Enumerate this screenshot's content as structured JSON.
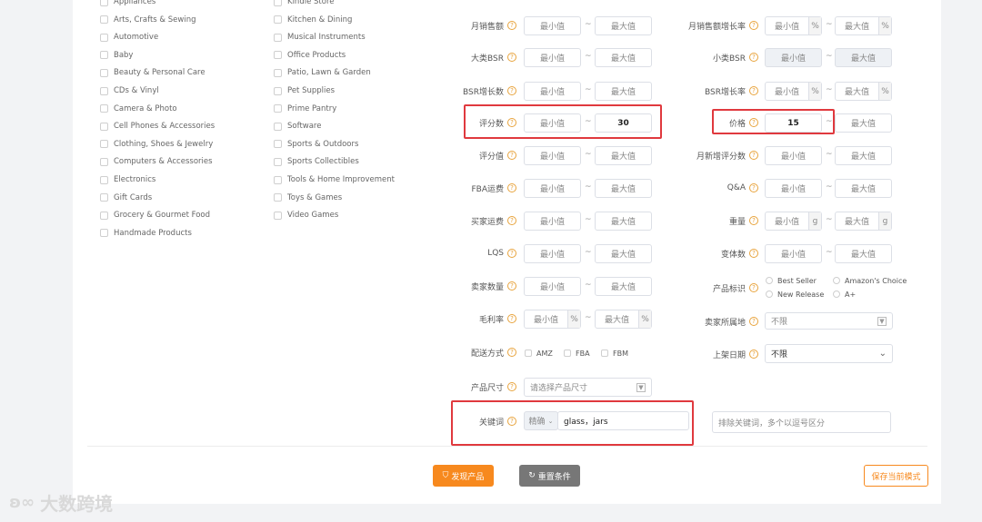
{
  "categories": {
    "col1": [
      "Appliances",
      "Arts, Crafts & Sewing",
      "Automotive",
      "Baby",
      "Beauty & Personal Care",
      "CDs & Vinyl",
      "Camera & Photo",
      "Cell Phones & Accessories",
      "Clothing, Shoes & Jewelry",
      "Computers & Accessories",
      "Electronics",
      "Gift Cards",
      "Grocery & Gourmet Food",
      "Handmade Products"
    ],
    "col2": [
      "Kindle Store",
      "Kitchen & Dining",
      "Musical Instruments",
      "Office Products",
      "Patio, Lawn & Garden",
      "Pet Supplies",
      "Prime Pantry",
      "Software",
      "Sports & Outdoors",
      "Sports Collectibles",
      "Tools & Home Improvement",
      "Toys & Games",
      "Video Games"
    ]
  },
  "placeholders": {
    "min": "最小值",
    "max": "最大值"
  },
  "filters": {
    "monthly_sales": {
      "label": "月销售额"
    },
    "big_bsr": {
      "label": "大类BSR"
    },
    "bsr_growth": {
      "label": "BSR增长数"
    },
    "review_count": {
      "label": "评分数",
      "max": "30"
    },
    "rating": {
      "label": "评分值"
    },
    "fba_fee": {
      "label": "FBA运费"
    },
    "buyer_shipping": {
      "label": "买家运费"
    },
    "lqs": {
      "label": "LQS"
    },
    "seller_count": {
      "label": "卖家数量"
    },
    "gross_margin": {
      "label": "毛利率",
      "unit": "%"
    },
    "delivery": {
      "label": "配送方式",
      "options": [
        "AMZ",
        "FBA",
        "FBM"
      ]
    },
    "product_size": {
      "label": "产品尺寸",
      "placeholder": "请选择产品尺寸"
    },
    "keyword": {
      "label": "关键词",
      "mode": "精确",
      "value": "glass，jars",
      "exclude_placeholder": "排除关键词，多个以逗号区分"
    },
    "sales_growth": {
      "label": "月销售额增长率",
      "unit": "%"
    },
    "sub_bsr": {
      "label": "小类BSR"
    },
    "bsr_growth_rate": {
      "label": "BSR增长率",
      "unit": "%"
    },
    "price": {
      "label": "价格",
      "min": "15"
    },
    "monthly_new_reviews": {
      "label": "月新增评分数"
    },
    "qa": {
      "label": "Q&A"
    },
    "weight": {
      "label": "重量",
      "unit": "g"
    },
    "variants": {
      "label": "变体数"
    },
    "product_badge": {
      "label": "产品标识",
      "options": [
        "Best Seller",
        "Amazon's Choice",
        "New Release",
        "A+"
      ]
    },
    "seller_location": {
      "label": "卖家所属地",
      "value": "不限"
    },
    "listing_date": {
      "label": "上架日期",
      "value": "不限"
    }
  },
  "actions": {
    "find": "发现产品",
    "reset": "重置条件",
    "save": "保存当前模式"
  },
  "watermark": "大数跨境",
  "colors": {
    "orange": "#f7891e",
    "gray_btn": "#777",
    "red_highlight": "#e0393e",
    "help_icon": "#e8a33c"
  }
}
